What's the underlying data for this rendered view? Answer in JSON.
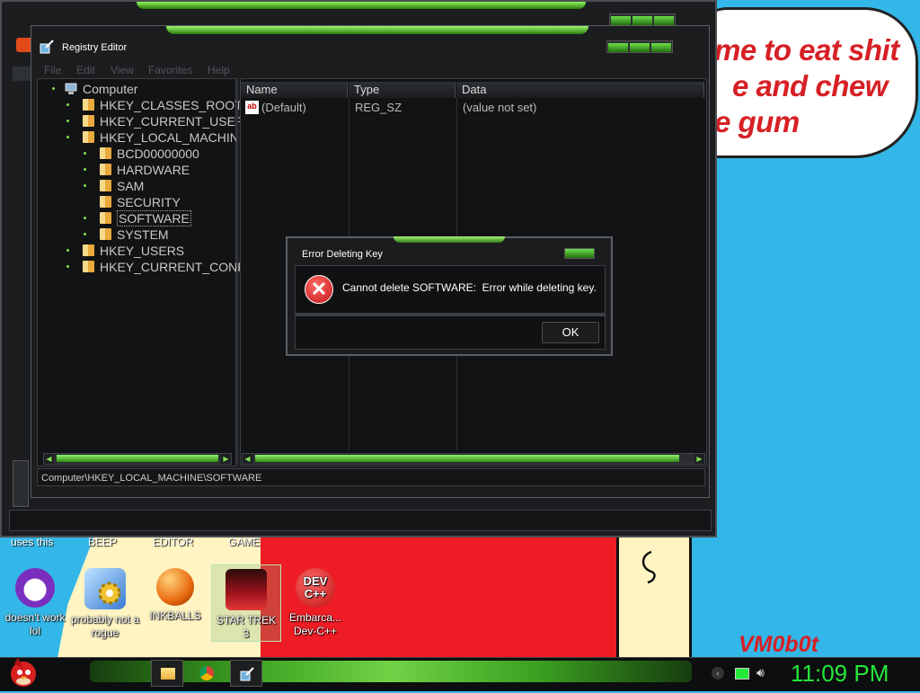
{
  "desktop": {
    "bubble_lines": [
      "me to eat shit",
      "e and chew",
      "e gum"
    ],
    "watermark": "VM0b0t",
    "partial_labels": [
      "uses this",
      "BEEP",
      "EDITOR",
      "GAME"
    ],
    "icons": [
      {
        "label": "doesn't work lol",
        "icon": "yahoo-messenger-icon"
      },
      {
        "label": "probably not a rogue",
        "icon": "gear-computer-icon"
      },
      {
        "label": "INKBALLS",
        "icon": "inkball-icon"
      },
      {
        "label": "STAR TREK 3",
        "icon": "star-trek-icon"
      },
      {
        "label": "Embarca... Dev-C++",
        "icon": "dev-cpp-icon"
      }
    ],
    "devcpp_icon_text": "DEV\nC++"
  },
  "registry_editor": {
    "title": "Registry Editor",
    "menu": [
      "File",
      "Edit",
      "View",
      "Favorites",
      "Help"
    ],
    "tree": {
      "root": "Computer",
      "items": [
        {
          "label": "HKEY_CLASSES_ROOT",
          "level": 1
        },
        {
          "label": "HKEY_CURRENT_USER",
          "level": 1
        },
        {
          "label": "HKEY_LOCAL_MACHINE",
          "level": 1
        },
        {
          "label": "BCD00000000",
          "level": 2
        },
        {
          "label": "HARDWARE",
          "level": 2
        },
        {
          "label": "SAM",
          "level": 2
        },
        {
          "label": "SECURITY",
          "level": 2
        },
        {
          "label": "SOFTWARE",
          "level": 2,
          "selected": true
        },
        {
          "label": "SYSTEM",
          "level": 2
        },
        {
          "label": "HKEY_USERS",
          "level": 1
        },
        {
          "label": "HKEY_CURRENT_CONFI",
          "level": 1
        }
      ]
    },
    "columns": [
      "Name",
      "Type",
      "Data"
    ],
    "values": [
      {
        "name": "(Default)",
        "type": "REG_SZ",
        "data": "(value not set)"
      }
    ],
    "status_path": "Computer\\HKEY_LOCAL_MACHINE\\SOFTWARE"
  },
  "dialog": {
    "title": "Error Deleting Key",
    "message": "Cannot delete SOFTWARE:  Error while deleting key.",
    "ok_label": "OK"
  },
  "taskbar": {
    "clock": "11:09 PM"
  },
  "colors": {
    "accent_green": "#3fae22",
    "clock_green": "#26e83a",
    "desktop_blue": "#33b7e8",
    "error_red": "#c4141b"
  }
}
